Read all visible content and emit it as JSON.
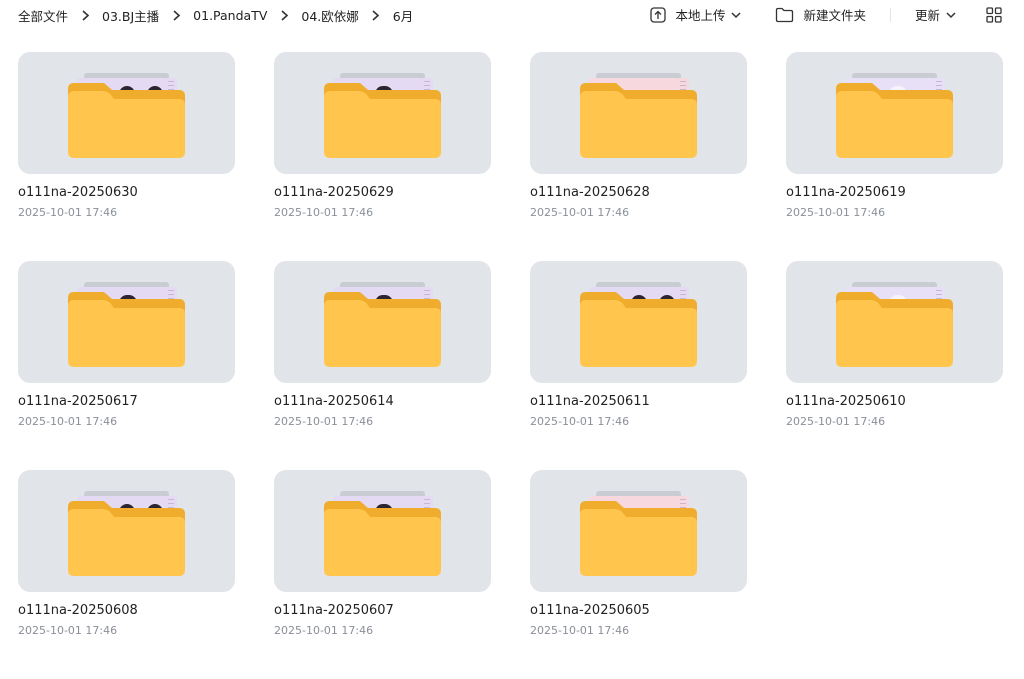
{
  "breadcrumb": [
    "全部文件",
    "03.BJ主播",
    "01.PandaTV",
    "04.欧依娜",
    "6月"
  ],
  "toolbar": {
    "upload_label": "本地上传",
    "new_folder_label": "新建文件夹",
    "sort_label": "更新"
  },
  "icons": {
    "upload": "upload-icon",
    "new_folder": "folder-outline-icon",
    "chevron": "chevron-down-icon",
    "view": "grid-view-icon",
    "separator": "chevron-right-icon"
  },
  "colors": {
    "folder_body": "#ffc54d",
    "folder_back": "#f0ac2c",
    "thumb_bg": "#e1e5ea",
    "date_text": "#8a8f99"
  },
  "folders": [
    {
      "name": "o111na-20250630",
      "date": "2025-10-01 17:46",
      "preview": "three"
    },
    {
      "name": "o111na-20250629",
      "date": "2025-10-01 17:46",
      "preview": "one"
    },
    {
      "name": "o111na-20250628",
      "date": "2025-10-01 17:46",
      "preview": "pink"
    },
    {
      "name": "o111na-20250619",
      "date": "2025-10-01 17:46",
      "preview": "lilac"
    },
    {
      "name": "o111na-20250617",
      "date": "2025-10-01 17:46",
      "preview": "one"
    },
    {
      "name": "o111na-20250614",
      "date": "2025-10-01 17:46",
      "preview": "one"
    },
    {
      "name": "o111na-20250611",
      "date": "2025-10-01 17:46",
      "preview": "three"
    },
    {
      "name": "o111na-20250610",
      "date": "2025-10-01 17:46",
      "preview": "lilac"
    },
    {
      "name": "o111na-20250608",
      "date": "2025-10-01 17:46",
      "preview": "three"
    },
    {
      "name": "o111na-20250607",
      "date": "2025-10-01 17:46",
      "preview": "one"
    },
    {
      "name": "o111na-20250605",
      "date": "2025-10-01 17:46",
      "preview": "pink"
    }
  ]
}
